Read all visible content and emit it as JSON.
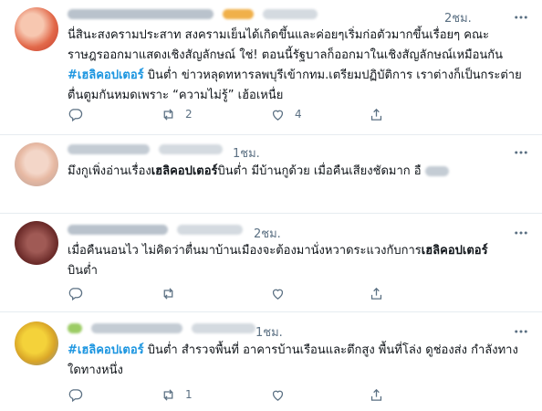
{
  "tweets": [
    {
      "time": "2ชม.",
      "text_before": "นี่สินะสงครามประสาท สงครามเย็นได้เกิดขึ้นและค่อยๆเริ่มก่อตัวมากขึ้นเรื่อยๆ คณะราษฎรออกมาแสดงเชิงสัญลักษณ์ ใช่! ตอนนี้รัฐบาลก็ออกมาในเชิงสัญลักษณ์เหมือนกัน ",
      "hashtag": "#เฮลิคอปเตอร์",
      "text_after": " บินต่ำ ข่าวหลุดทหารลพบุรีเข้ากทม.เตรียมปฏิบัติการ เราต่างก็เป็นกระต่ายตื่นตูมกันหมดเพราะ “ความไม่รู้” เฮ้อเหนื่ย",
      "retweets": "2",
      "likes": "4"
    },
    {
      "time": "1ชม.",
      "text_before": "มึงกูเพิ่งอ่านเรื่อง",
      "bold": "เฮลิคอปเตอร์",
      "text_after": "บินต่ำ มีบ้านกูด้วย เมื่อคืนเสียงชัดมาก อื"
    },
    {
      "time": "2ชม.",
      "text_before": "เมื่อคืนนอนไว ไม่คิดว่าตื่นมาบ้านเมืองจะต้องมานั่งหวาดระแวงกับการ",
      "bold": "เฮลิคอปเตอร์",
      "text_after": "บินต่ำ"
    },
    {
      "time": "1ชม.",
      "hashtag": "#เฮลิคอปเตอร์",
      "text_after": " บินต่ำ สำรวจพื้นที่ อาคารบ้านเรือนและตึกสูง พื้นที่โล่ง ดูช่องส่ง กำลังทางใดทางหนึ่ง",
      "retweets": "1"
    }
  ],
  "icon_color": "#5b7083",
  "hashtag_color": "#1b95e0"
}
